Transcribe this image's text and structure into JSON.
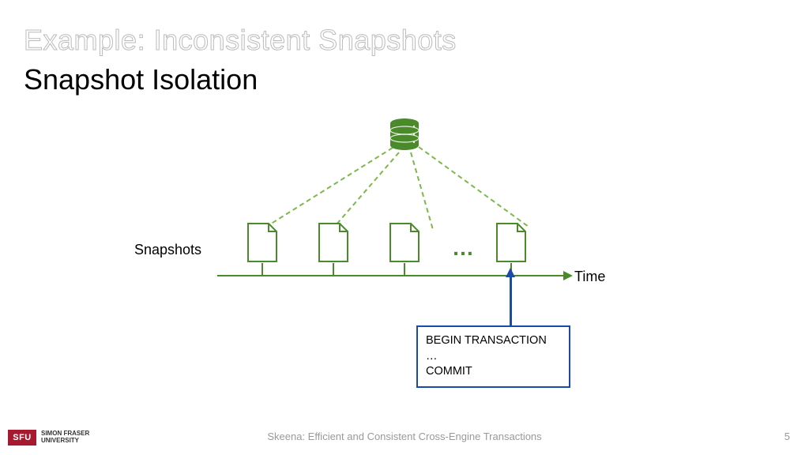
{
  "title": "Example: Inconsistent Snapshots",
  "subtitle": "Snapshot Isolation",
  "labels": {
    "snapshots": "Snapshots",
    "time": "Time",
    "ellipsis": "…"
  },
  "transaction": {
    "line1": "BEGIN TRANSACTION",
    "line2": "…",
    "line3": "COMMIT"
  },
  "footer": {
    "logo_abbr": "SFU",
    "logo_name": "SIMON FRASER\nUNIVERSITY",
    "paper_title": "Skeena: Efficient and Consistent Cross-Engine Transactions",
    "page": "5"
  },
  "colors": {
    "green": "#4a8a2a",
    "green_light": "#7db84a",
    "blue": "#1a4ba8",
    "sfu_red": "#a6192e"
  }
}
